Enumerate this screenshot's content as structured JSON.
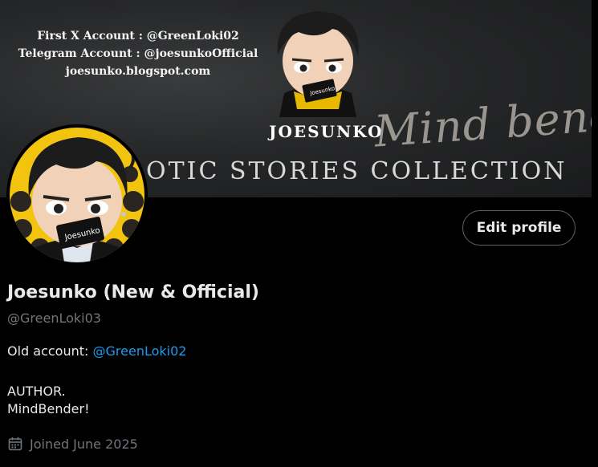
{
  "banner": {
    "lines": [
      "First X Account  : @GreenLoki02",
      "Telegram Account :  @joesunkoOfficial",
      "joesunko.blogspot.com"
    ],
    "brand": "JOESUNKO",
    "script": "Mind bender",
    "collection": "OTIC STORIES COLLECTION",
    "mascot_card": "Joesunko"
  },
  "avatar": {
    "card_text": "Joesunko"
  },
  "actions": {
    "edit_label": "Edit profile"
  },
  "profile": {
    "name": "Joesunko (New & Official)",
    "handle": "@GreenLoki03",
    "bio_prefix": "Old account: ",
    "bio_link": "@GreenLoki02",
    "bio_line2": "AUTHOR.",
    "bio_line3": "MindBender!",
    "joined": "Joined June 2025"
  },
  "icons": {
    "joined": "calendar-icon"
  },
  "colors": {
    "link": "#1d9bf0",
    "muted": "#71767b",
    "text": "#e7e9ea",
    "background": "#000000",
    "avatar_bg": "#f2c40f"
  }
}
